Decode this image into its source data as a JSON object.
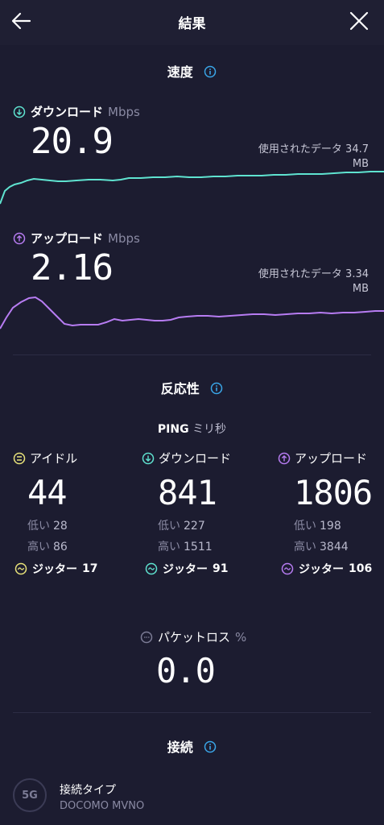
{
  "header": {
    "title": "結果"
  },
  "speed": {
    "section_title": "速度",
    "download": {
      "label": "ダウンロード",
      "unit": "Mbps",
      "value": "20.9",
      "data_used_line1": "使用されたデータ 34.7",
      "data_used_line2": "MB"
    },
    "upload": {
      "label": "アップロード",
      "unit": "Mbps",
      "value": "2.16",
      "data_used_line1": "使用されたデータ 3.34",
      "data_used_line2": "MB"
    }
  },
  "responsiveness": {
    "section_title": "反応性",
    "ping_label": "PING",
    "ping_unit": "ミリ秒",
    "idle": {
      "label": "アイドル",
      "value": "44",
      "low_label": "低い",
      "low": "28",
      "high_label": "高い",
      "high": "86",
      "jitter_label": "ジッター",
      "jitter": "17"
    },
    "download": {
      "label": "ダウンロード",
      "value": "841",
      "low_label": "低い",
      "low": "227",
      "high_label": "高い",
      "high": "1511",
      "jitter_label": "ジッター",
      "jitter": "91"
    },
    "upload": {
      "label": "アップロード",
      "value": "1806",
      "low_label": "低い",
      "low": "198",
      "high_label": "高い",
      "high": "3844",
      "jitter_label": "ジッター",
      "jitter": "106"
    }
  },
  "packet_loss": {
    "label": "パケットロス",
    "unit": "%",
    "value": "0.0"
  },
  "connection": {
    "section_title": "接続",
    "icon_text": "5G",
    "type_label": "接続タイプ",
    "type_value": "DOCOMO MVNO"
  },
  "colors": {
    "download": "#5fe3d0",
    "upload": "#b77cf2",
    "idle": "#e9e37a",
    "background": "#1c1c30"
  }
}
